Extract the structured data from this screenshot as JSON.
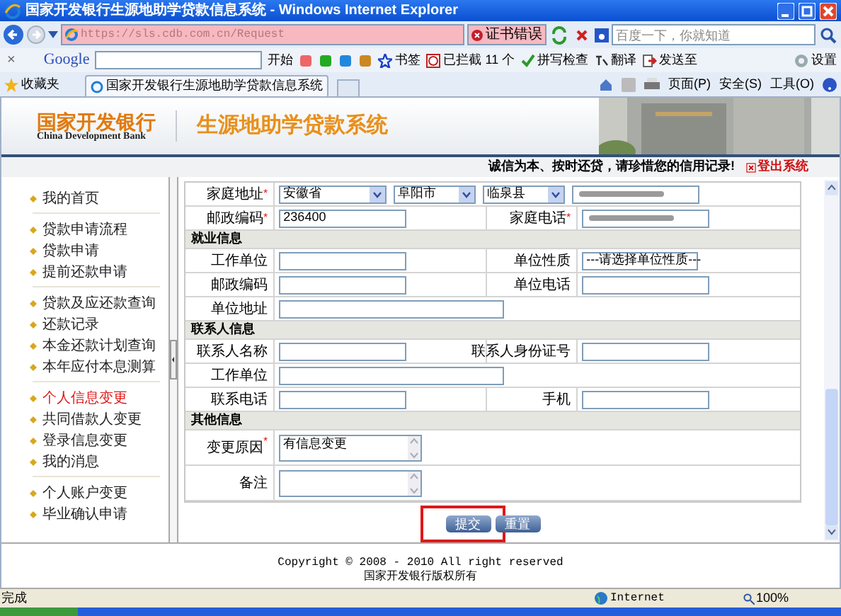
{
  "window": {
    "title": "国家开发银行生源地助学贷款信息系统 - Windows Internet Explorer"
  },
  "address_bar": {
    "url": "https://sls.cdb.com.cn/Request",
    "cert_error": "证书错误",
    "search_placeholder": "百度一下，你就知道"
  },
  "google_toolbar": {
    "close": "×",
    "logo": "Google",
    "items": [
      {
        "label": "开始",
        "kind": "text"
      },
      {
        "label": "书签",
        "kind": "star"
      },
      {
        "label": "已拦截 11 个",
        "kind": "block"
      },
      {
        "label": "拼写检查",
        "kind": "check"
      },
      {
        "label": "翻译",
        "kind": "translate"
      },
      {
        "label": "发送至",
        "kind": "send"
      },
      {
        "label": "设置",
        "kind": "gear"
      }
    ]
  },
  "favorites_bar": {
    "favorites": "收藏夹",
    "tab_title": "国家开发银行生源地助学贷款信息系统",
    "commands": [
      "页面(P)",
      "安全(S)",
      "工具(O)"
    ]
  },
  "header": {
    "logo_cn": "国家开发银行",
    "logo_en": "China Development Bank",
    "system_title": "生源地助学贷款系统",
    "slogan": "诚信为本、按时还贷，请珍惜您的信用记录!",
    "logout": "登出系统"
  },
  "sidebar": {
    "groups": [
      [
        {
          "label": "我的首页",
          "selected": false
        }
      ],
      [
        {
          "label": "贷款申请流程",
          "selected": false
        },
        {
          "label": "贷款申请",
          "selected": false
        },
        {
          "label": "提前还款申请",
          "selected": false
        }
      ],
      [
        {
          "label": "贷款及应还款查询",
          "selected": false
        },
        {
          "label": "还款记录",
          "selected": false
        },
        {
          "label": "本金还款计划查询",
          "selected": false
        },
        {
          "label": "本年应付本息测算",
          "selected": false
        }
      ],
      [
        {
          "label": "个人信息变更",
          "selected": true
        },
        {
          "label": "共同借款人变更",
          "selected": false
        },
        {
          "label": "登录信息变更",
          "selected": false
        },
        {
          "label": "我的消息",
          "selected": false
        }
      ],
      [
        {
          "label": "个人账户变更",
          "selected": false
        },
        {
          "label": "毕业确认申请",
          "selected": false
        }
      ]
    ]
  },
  "form": {
    "rows": [
      {
        "kind": "address",
        "label": "家庭地址",
        "required_mark": "*",
        "selects": [
          "安徽省",
          "阜阳市",
          "临泉县"
        ],
        "redacted": true
      },
      {
        "kind": "pair",
        "fields": [
          {
            "label": "邮政编码",
            "required_mark": "*",
            "kind": "input",
            "value": "236400"
          },
          {
            "label": "家庭电话",
            "required_mark": "*",
            "kind": "redacted"
          }
        ]
      },
      {
        "kind": "section",
        "title": "就业信息"
      },
      {
        "kind": "pair",
        "fields": [
          {
            "label": "工作单位",
            "kind": "input"
          },
          {
            "label": "单位性质",
            "kind": "select",
            "value": "---请选择单位性质---"
          }
        ]
      },
      {
        "kind": "pair",
        "fields": [
          {
            "label": "邮政编码",
            "kind": "input"
          },
          {
            "label": "单位电话",
            "kind": "input"
          }
        ]
      },
      {
        "kind": "wide",
        "label": "单位地址"
      },
      {
        "kind": "section",
        "title": "联系人信息"
      },
      {
        "kind": "pair",
        "fields": [
          {
            "label": "联系人名称",
            "kind": "input"
          },
          {
            "label": "联系人身份证号",
            "kind": "input"
          }
        ]
      },
      {
        "kind": "wide",
        "label": "工作单位"
      },
      {
        "kind": "pair",
        "fields": [
          {
            "label": "联系电话",
            "kind": "input"
          },
          {
            "label": "手机",
            "kind": "input"
          }
        ]
      },
      {
        "kind": "section",
        "title": "其他信息"
      },
      {
        "kind": "textarea",
        "label": "变更原因",
        "required_mark": "*",
        "value": "有信息变更"
      },
      {
        "kind": "textarea",
        "label": "备注"
      }
    ],
    "buttons": [
      {
        "label": "提交",
        "highlighted": true
      },
      {
        "label": "重置",
        "highlighted": false
      }
    ]
  },
  "footer": {
    "copyright": "Copyright © 2008 - 2010 All right reserved",
    "owner": "国家开发银行版权所有"
  },
  "status_bar": {
    "status": "完成",
    "zone": "Internet",
    "zoom": "100%"
  }
}
